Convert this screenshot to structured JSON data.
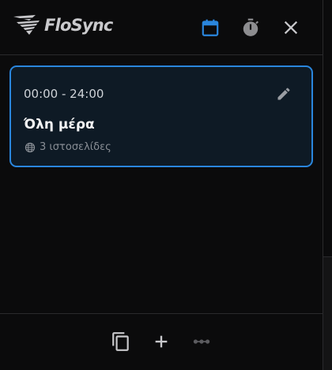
{
  "app": {
    "title": "FloSync",
    "accent_color": "#2a86dd"
  },
  "header": {
    "buttons": [
      {
        "icon": "calendar-icon",
        "active": true
      },
      {
        "icon": "timer-icon",
        "active": false
      },
      {
        "icon": "close-icon",
        "active": false
      }
    ]
  },
  "schedule": {
    "items": [
      {
        "time_range": "00:00 - 24:00",
        "title": "Όλη μέρα",
        "sites_label": "3 ιστοσελίδες",
        "selected": true
      }
    ]
  },
  "footer": {
    "buttons": [
      {
        "icon": "copy-icon"
      },
      {
        "icon": "add-icon"
      },
      {
        "icon": "more-icon",
        "enabled": false
      }
    ]
  }
}
